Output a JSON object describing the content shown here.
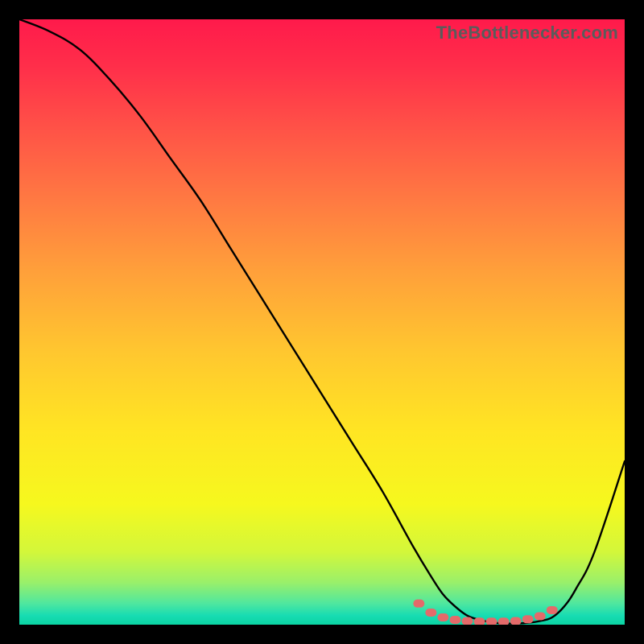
{
  "watermark": "TheBottlenecker.com",
  "chart_data": {
    "type": "line",
    "title": "",
    "xlabel": "",
    "ylabel": "",
    "xlim": [
      0,
      100
    ],
    "ylim": [
      0,
      100
    ],
    "grid": false,
    "legend": false,
    "background": "rainbow-vertical-gradient",
    "curve_color": "#000000",
    "marker_color": "#e46a6a",
    "x": [
      0,
      5,
      10,
      15,
      20,
      25,
      30,
      35,
      40,
      45,
      50,
      55,
      60,
      65,
      68,
      70,
      72,
      74,
      76,
      78,
      80,
      82,
      84,
      86,
      88,
      90,
      92,
      95,
      100
    ],
    "y": [
      100,
      98,
      95,
      90,
      84,
      77,
      70,
      62,
      54,
      46,
      38,
      30,
      22,
      13,
      8,
      5,
      3,
      1.5,
      0.8,
      0.4,
      0.2,
      0.2,
      0.3,
      0.6,
      1.2,
      3,
      6,
      12,
      27
    ],
    "markers": {
      "x": [
        66,
        68,
        70,
        72,
        74,
        76,
        78,
        80,
        82,
        84,
        86,
        88
      ],
      "y": [
        3.5,
        2.0,
        1.2,
        0.8,
        0.6,
        0.5,
        0.5,
        0.5,
        0.6,
        0.9,
        1.4,
        2.4
      ]
    },
    "gradient_stops": [
      {
        "offset": 0.0,
        "color": "#ff1a4b"
      },
      {
        "offset": 0.08,
        "color": "#ff2f4a"
      },
      {
        "offset": 0.18,
        "color": "#ff5247"
      },
      {
        "offset": 0.3,
        "color": "#ff7a42"
      },
      {
        "offset": 0.42,
        "color": "#ffa13a"
      },
      {
        "offset": 0.55,
        "color": "#ffc72f"
      },
      {
        "offset": 0.68,
        "color": "#ffe523"
      },
      {
        "offset": 0.8,
        "color": "#f6f81e"
      },
      {
        "offset": 0.88,
        "color": "#d3f73a"
      },
      {
        "offset": 0.93,
        "color": "#9af06a"
      },
      {
        "offset": 0.965,
        "color": "#4fe79f"
      },
      {
        "offset": 0.985,
        "color": "#17dcb2"
      },
      {
        "offset": 1.0,
        "color": "#0bd4a3"
      }
    ]
  }
}
